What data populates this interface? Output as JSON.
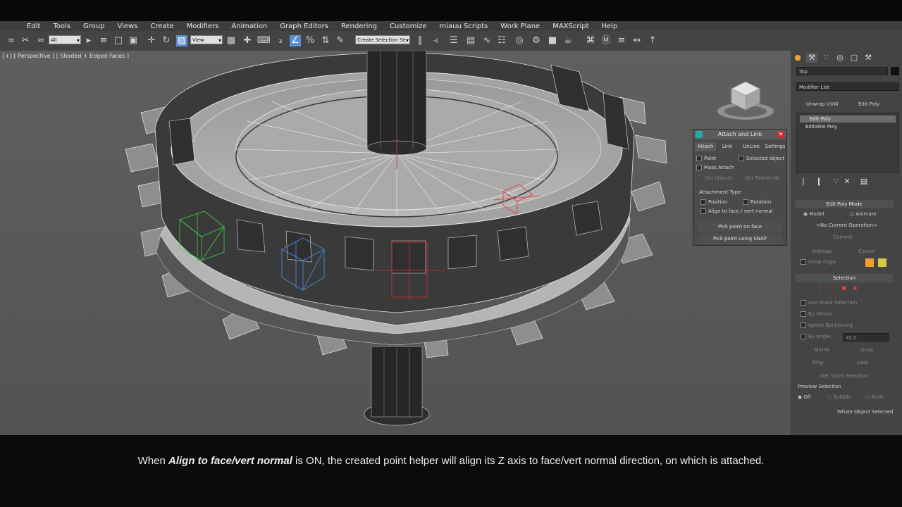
{
  "menubar": [
    "Edit",
    "Tools",
    "Group",
    "Views",
    "Create",
    "Modifiers",
    "Animation",
    "Graph Editors",
    "Rendering",
    "Customize",
    "miauu Scripts",
    "Work Plane",
    "MAXScript",
    "Help"
  ],
  "toolbar": {
    "filter_value": "All",
    "coord_value": "View",
    "selection_set_placeholder": "Create Selection Se"
  },
  "viewport": {
    "label": "[+] [ Perspective ] [ Shaded + Edged Faces ]"
  },
  "command_panel": {
    "object_name": "Top",
    "modifier_list": "Modifier List",
    "unwrap_button": "Unwrap UVW",
    "edit_poly_button": "Edit Poly",
    "stack": [
      "Edit Poly",
      "Editable Poly"
    ],
    "edit_poly_mode": {
      "title": "Edit Poly Mode",
      "model": "Model",
      "animate": "Animate",
      "status": "<No Current Operation>",
      "commit": "Commit",
      "settings": "Settings",
      "cancel": "Cancel",
      "show_cage": "Show Cage"
    },
    "selection": {
      "title": "Selection",
      "use_stack": "Use Stack Selection",
      "by_vertex": "By Vertex",
      "ignore_backfacing": "Ignore Backfacing",
      "by_angle": "By Angle:",
      "angle_value": "45.0",
      "shrink": "Shrink",
      "grow": "Grow",
      "ring": "Ring",
      "loop": "Loop",
      "get_stack": "Get Stack Selection",
      "preview_title": "Preview Selection",
      "off": "Off",
      "subobj": "SubObj",
      "multi": "Multi",
      "whole": "Whole Object Selected"
    },
    "accent_color": "#f0a030"
  },
  "dialog": {
    "title": "Attach and Link",
    "tabs": [
      "Attach",
      "Link",
      "UnLink",
      "Settings"
    ],
    "point": "Point",
    "selected_object": "Selected object",
    "mass_attach": "Mass Attach",
    "set_objects": "Set objects",
    "set_parent": "Set Parent obj",
    "attachment_type": "Attachment Type",
    "position": "Position",
    "rotation": "Rotation",
    "align": "Align to face / vert normal",
    "pick_face": "Pick point on face",
    "pick_snap": "Pick point using SNAP"
  },
  "subtitle": {
    "pre": "When ",
    "bold": "Align to face/vert normal",
    "post": " is ON, the created point helper will align its Z axis to face/vert normal direction, on which is attached."
  }
}
